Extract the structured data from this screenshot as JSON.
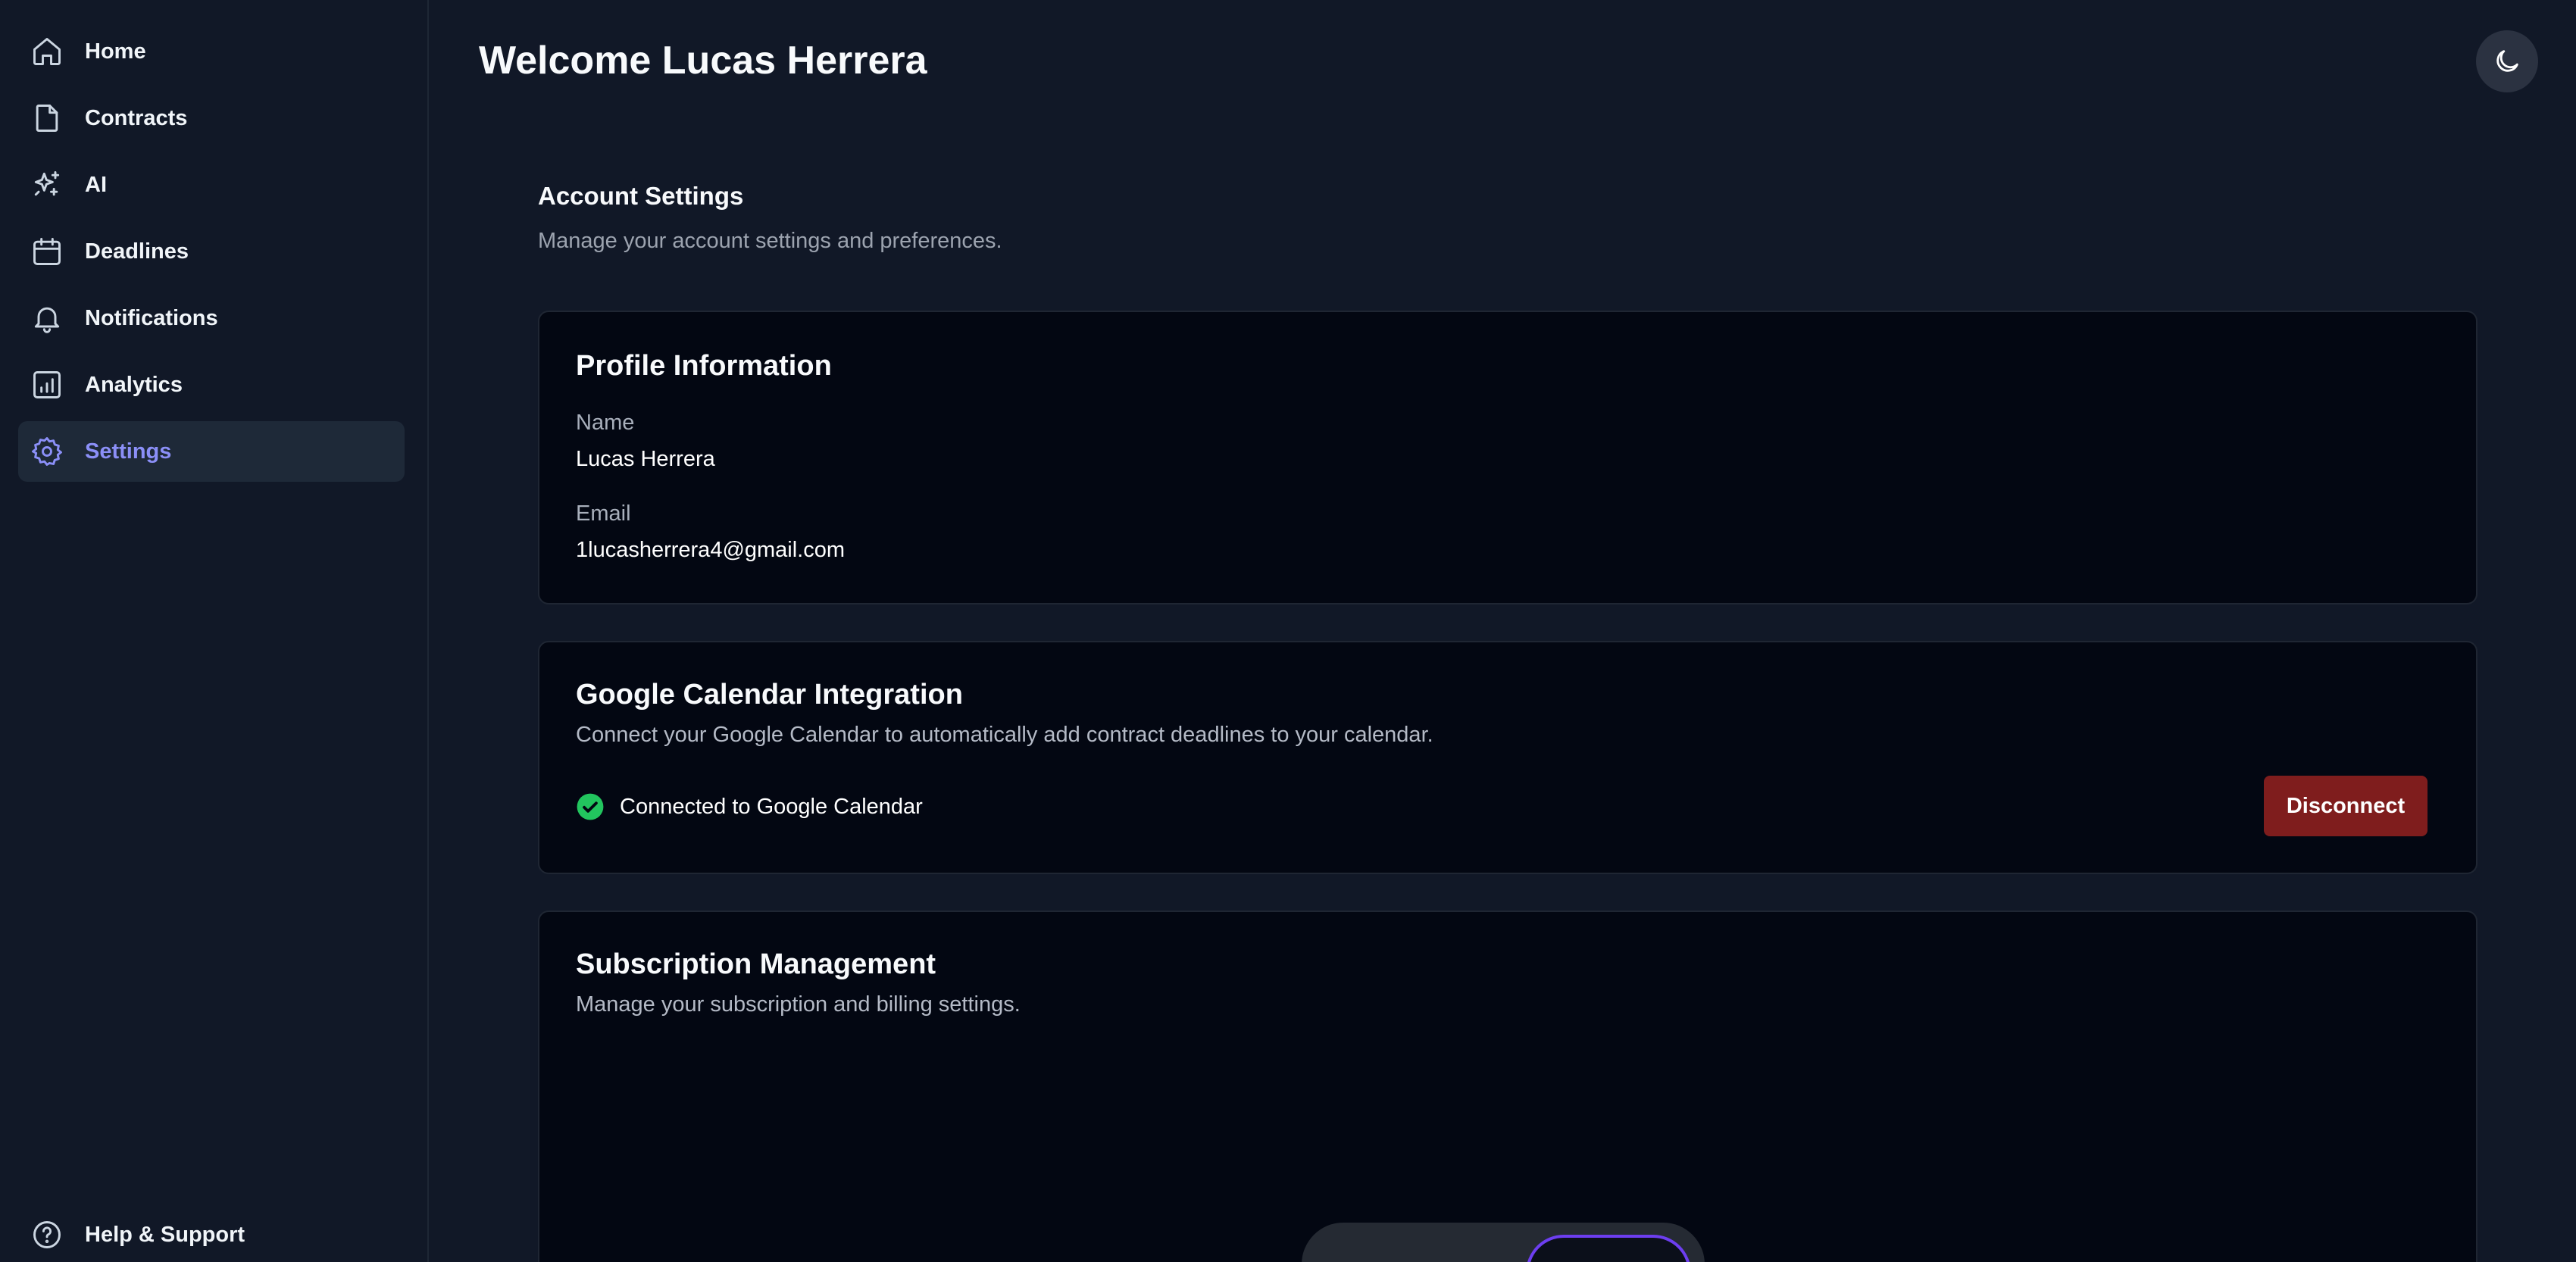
{
  "sidebar": {
    "items": [
      {
        "label": "Home",
        "icon": "home-icon",
        "active": false
      },
      {
        "label": "Contracts",
        "icon": "file-icon",
        "active": false
      },
      {
        "label": "AI",
        "icon": "sparkles-icon",
        "active": false
      },
      {
        "label": "Deadlines",
        "icon": "calendar-icon",
        "active": false
      },
      {
        "label": "Notifications",
        "icon": "bell-icon",
        "active": false
      },
      {
        "label": "Analytics",
        "icon": "bar-chart-icon",
        "active": false
      },
      {
        "label": "Settings",
        "icon": "gear-icon",
        "active": true
      }
    ],
    "help": {
      "label": "Help & Support",
      "icon": "help-circle-icon"
    }
  },
  "header": {
    "welcome": "Welcome Lucas Herrera",
    "theme_icon": "moon-icon"
  },
  "account": {
    "title": "Account Settings",
    "subtitle": "Manage your account settings and preferences."
  },
  "profile": {
    "title": "Profile Information",
    "name_label": "Name",
    "name_value": "Lucas Herrera",
    "email_label": "Email",
    "email_value": "1lucasherrera4@gmail.com"
  },
  "calendar": {
    "title": "Google Calendar Integration",
    "subtitle": "Connect your Google Calendar to automatically add contract deadlines to your calendar.",
    "status_text": "Connected to Google Calendar",
    "status_icon": "check-circle-icon",
    "disconnect_label": "Disconnect"
  },
  "subscription": {
    "title": "Subscription Management",
    "subtitle": "Manage your subscription and billing settings."
  },
  "colors": {
    "background": "#111827",
    "card": "#030712",
    "accent": "#8b8ff7",
    "danger": "#7f1d1d",
    "success": "#22c55e"
  }
}
